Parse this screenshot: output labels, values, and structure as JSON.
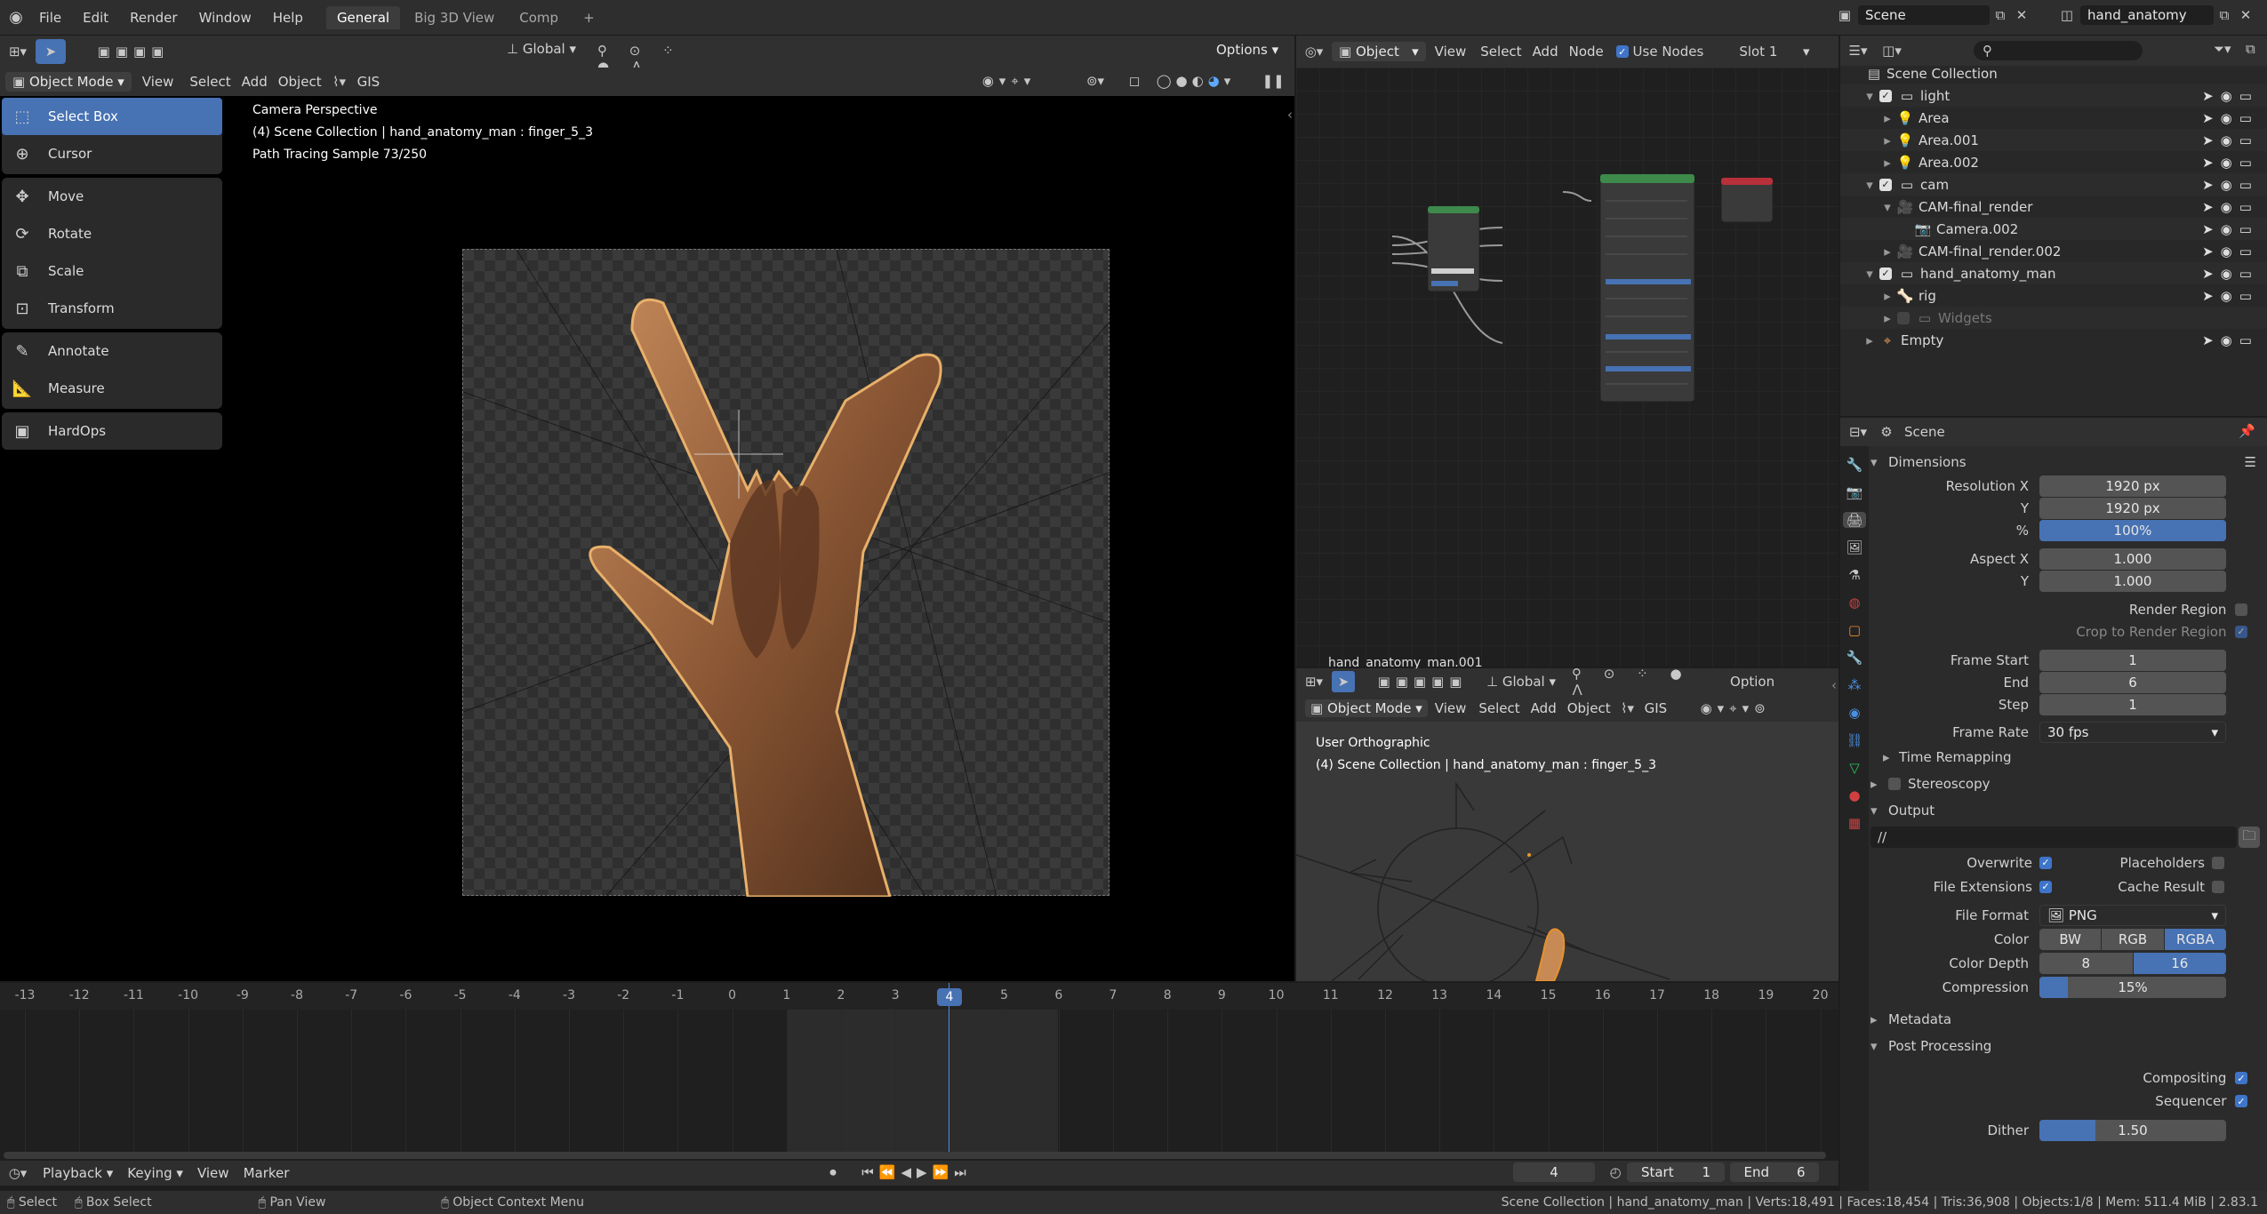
{
  "topbar": {
    "menus": [
      "File",
      "Edit",
      "Render",
      "Window",
      "Help"
    ],
    "workspaces": [
      "General",
      "Big 3D View",
      "Comp"
    ],
    "active_workspace": "General",
    "scene": "Scene",
    "view_layer": "hand_anatomy"
  },
  "viewport": {
    "mode": "Object Mode",
    "menus": [
      "View",
      "Select",
      "Add",
      "Object",
      "GIS"
    ],
    "orientation": "Global",
    "options": "Options",
    "overlay_lines": [
      "Camera Perspective",
      "(4) Scene Collection | hand_anatomy_man : finger_5_3",
      "Path Tracing Sample 73/250"
    ],
    "tools": [
      [
        "Select Box",
        "Cursor"
      ],
      [
        "Move",
        "Rotate",
        "Scale",
        "Transform"
      ],
      [
        "Annotate",
        "Measure"
      ],
      [
        "HardOps"
      ]
    ]
  },
  "node_editor": {
    "type": "Object",
    "menus": [
      "View",
      "Select",
      "Add",
      "Node"
    ],
    "use_nodes": "Use Nodes",
    "slot": "Slot 1",
    "material": "hand_anatomy_man.001"
  },
  "small_viewport": {
    "mode": "Object Mode",
    "menus": [
      "View",
      "Select",
      "Add",
      "Object",
      "GIS"
    ],
    "orientation": "Global",
    "options": "Option",
    "overlay_lines": [
      "User Orthographic",
      "(4) Scene Collection | hand_anatomy_man : finger_5_3"
    ]
  },
  "timeline": {
    "ticks": [
      "-13",
      "-12",
      "-11",
      "-10",
      "-9",
      "-8",
      "-7",
      "-6",
      "-5",
      "-4",
      "-3",
      "-2",
      "-1",
      "0",
      "1",
      "2",
      "3",
      "4",
      "5",
      "6",
      "7",
      "8",
      "9",
      "10",
      "11",
      "12",
      "13",
      "14",
      "15",
      "16",
      "17",
      "18",
      "19",
      "20"
    ],
    "current_frame": "4",
    "menus": [
      "Playback",
      "Keying",
      "View",
      "Marker"
    ],
    "frame_field": "4",
    "start_label": "Start",
    "start": "1",
    "end_label": "End",
    "end": "6"
  },
  "outliner": {
    "root": "Scene Collection",
    "items": [
      {
        "name": "light",
        "depth": 1,
        "kind": "collection"
      },
      {
        "name": "Area",
        "depth": 2,
        "kind": "light"
      },
      {
        "name": "Area.001",
        "depth": 2,
        "kind": "light"
      },
      {
        "name": "Area.002",
        "depth": 2,
        "kind": "light"
      },
      {
        "name": "cam",
        "depth": 1,
        "kind": "collection"
      },
      {
        "name": "CAM-final_render",
        "depth": 2,
        "kind": "camera"
      },
      {
        "name": "Camera.002",
        "depth": 3,
        "kind": "cameradata"
      },
      {
        "name": "CAM-final_render.002",
        "depth": 2,
        "kind": "camera"
      },
      {
        "name": "hand_anatomy_man",
        "depth": 1,
        "kind": "collection"
      },
      {
        "name": "rig",
        "depth": 2,
        "kind": "armature"
      },
      {
        "name": "Widgets",
        "depth": 2,
        "kind": "collection-dim"
      },
      {
        "name": "Empty",
        "depth": 1,
        "kind": "empty"
      }
    ]
  },
  "properties": {
    "context": "Scene",
    "dimensions": "Dimensions",
    "res_x_label": "Resolution X",
    "res_x": "1920 px",
    "res_y_label": "Y",
    "res_y": "1920 px",
    "pct_label": "%",
    "pct": "100%",
    "aspect_x_label": "Aspect X",
    "aspect_x": "1.000",
    "aspect_y_label": "Y",
    "aspect_y": "1.000",
    "render_region": "Render Region",
    "crop": "Crop to Render Region",
    "frame_start_label": "Frame Start",
    "frame_start": "1",
    "end_label": "End",
    "end": "6",
    "step_label": "Step",
    "step": "1",
    "frame_rate_label": "Frame Rate",
    "frame_rate": "30 fps",
    "time_remapping": "Time Remapping",
    "stereoscopy": "Stereoscopy",
    "output": "Output",
    "output_path": "//",
    "overwrite": "Overwrite",
    "placeholders": "Placeholders",
    "file_ext": "File Extensions",
    "cache_result": "Cache Result",
    "file_format_label": "File Format",
    "file_format": "PNG",
    "color_label": "Color",
    "color_opts": [
      "BW",
      "RGB",
      "RGBA"
    ],
    "depth_label": "Color Depth",
    "depth_opts": [
      "8",
      "16"
    ],
    "compression_label": "Compression",
    "compression": "15%",
    "compression_fraction": 0.15,
    "metadata": "Metadata",
    "post_processing": "Post Processing",
    "compositing": "Compositing",
    "sequencer": "Sequencer",
    "dither_label": "Dither",
    "dither": "1.50",
    "dither_fraction": 0.3
  },
  "status": {
    "select": "Select",
    "box_select": "Box Select",
    "pan": "Pan View",
    "context_menu": "Object Context Menu",
    "stats": "Scene Collection | hand_anatomy_man | Verts:18,491 | Faces:18,454 | Tris:36,908 | Objects:1/8 | Mem: 511.4 MiB | 2.83.1"
  }
}
